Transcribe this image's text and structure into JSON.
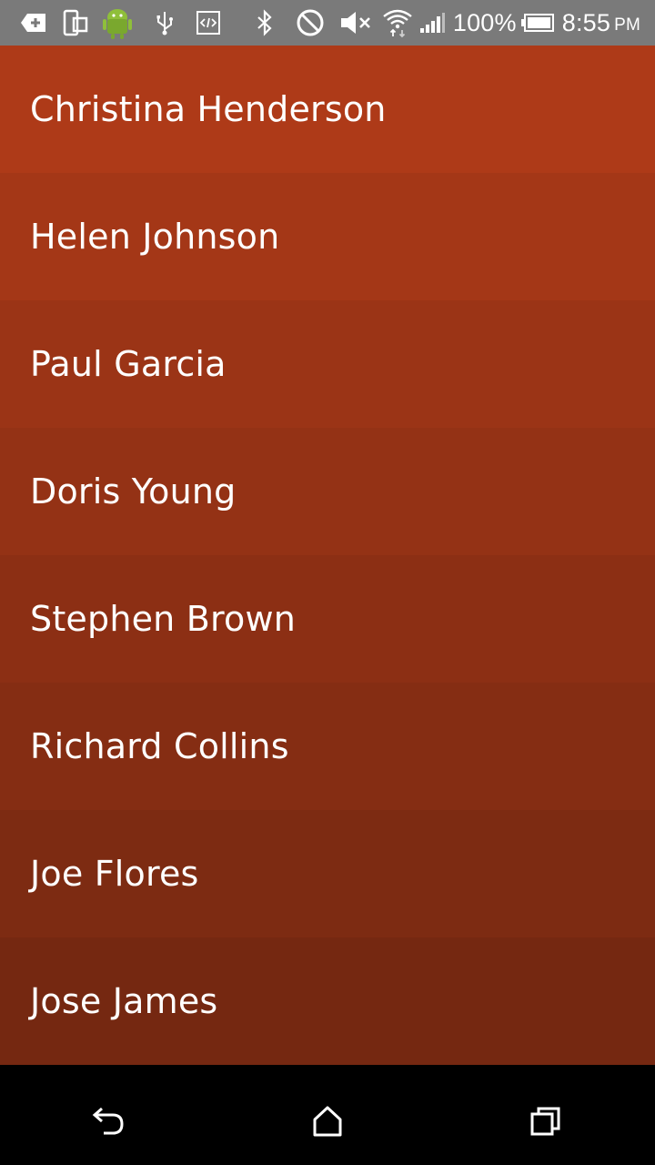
{
  "status_bar": {
    "battery_percent": "100%",
    "time": "8:55",
    "ampm": "PM",
    "left_icons": [
      "add-icon",
      "device-rotate-icon",
      "android-debug-icon",
      "usb-icon",
      "code-icon"
    ],
    "right_icons": [
      "bluetooth-icon",
      "do-not-disturb-icon",
      "volume-mute-icon",
      "wifi-icon",
      "signal-icon",
      "battery-icon"
    ],
    "background": "#7a7a7a"
  },
  "list": {
    "items": [
      {
        "label": "Christina Henderson",
        "color": "#ae3a18"
      },
      {
        "label": "Helen Johnson",
        "color": "#a43717"
      },
      {
        "label": "Paul Garcia",
        "color": "#9b3416"
      },
      {
        "label": "Doris Young",
        "color": "#943215"
      },
      {
        "label": "Stephen Brown",
        "color": "#8c2f14"
      },
      {
        "label": "Richard Collins",
        "color": "#852d13"
      },
      {
        "label": "Joe Flores",
        "color": "#7d2b12"
      },
      {
        "label": "Jose James",
        "color": "#752811"
      }
    ]
  },
  "nav_bar": {
    "buttons": [
      "back-icon",
      "home-icon",
      "recents-icon"
    ]
  }
}
